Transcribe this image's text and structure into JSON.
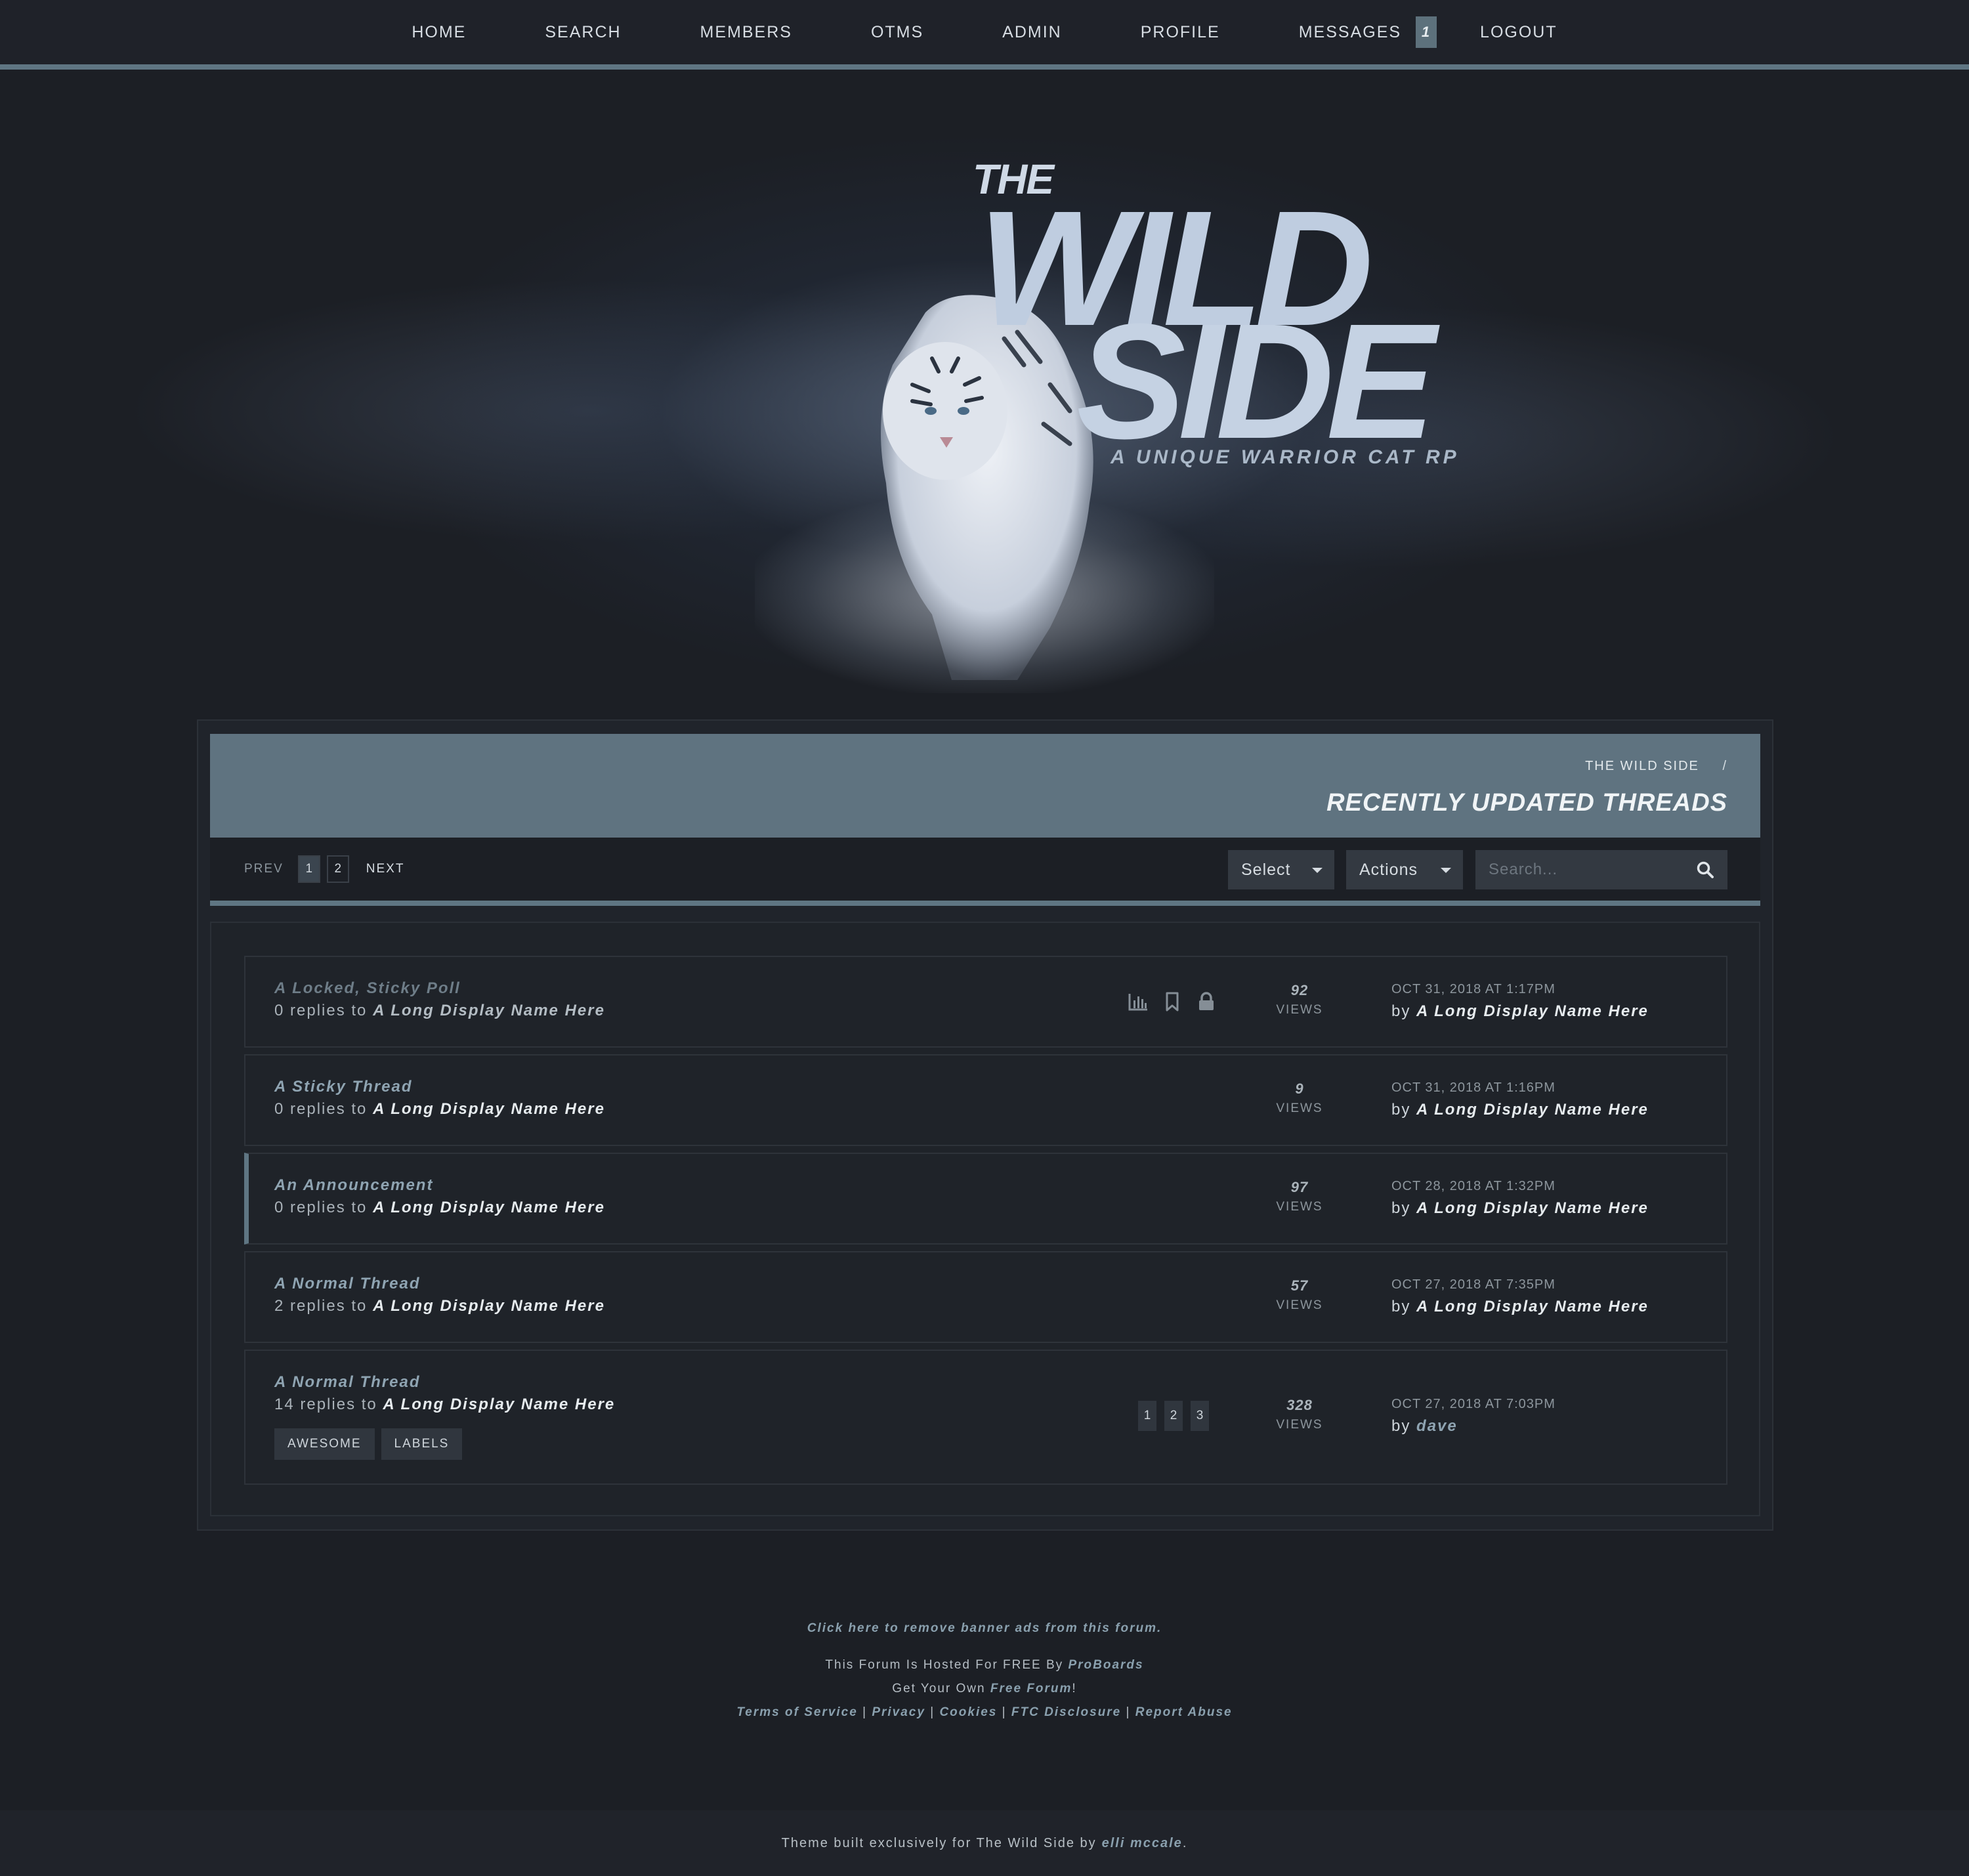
{
  "nav": {
    "items": [
      "HOME",
      "SEARCH",
      "MEMBERS",
      "OTMS",
      "ADMIN",
      "PROFILE",
      "MESSAGES",
      "LOGOUT"
    ],
    "messages_count": "1"
  },
  "banner": {
    "logo_the": "THE",
    "logo_wild": "WILD",
    "logo_side": "SIDE",
    "tagline": "A UNIQUE WARRIOR CAT RP"
  },
  "header": {
    "breadcrumb": "THE WILD SIDE",
    "breadcrumb_sep": "/",
    "title": "RECENTLY UPDATED THREADS"
  },
  "controls": {
    "prev": "PREV",
    "pages": [
      "1",
      "2"
    ],
    "active_page": "1",
    "next": "NEXT",
    "select_label": "Select",
    "actions_label": "Actions",
    "search_placeholder": "Search..."
  },
  "threads": [
    {
      "title": "A Locked, Sticky Poll",
      "replies": "0 replies to",
      "author": "A Long Display Name Here",
      "views": "92",
      "views_label": "VIEWS",
      "date": "OCT 31, 2018 AT 1:17PM",
      "by": "by",
      "last_author": "A Long Display Name Here",
      "icons": [
        "poll-icon",
        "bookmark-icon",
        "lock-icon"
      ]
    },
    {
      "title": "A Sticky Thread",
      "replies": "0 replies to",
      "author": "A Long Display Name Here",
      "views": "9",
      "views_label": "VIEWS",
      "date": "OCT 31, 2018 AT 1:16PM",
      "by": "by",
      "last_author": "A Long Display Name Here"
    },
    {
      "title": "An Announcement",
      "replies": "0 replies to",
      "author": "A Long Display Name Here",
      "views": "97",
      "views_label": "VIEWS",
      "date": "OCT 28, 2018 AT 1:32PM",
      "by": "by",
      "last_author": "A Long Display Name Here"
    },
    {
      "title": "A Normal Thread",
      "replies": "2 replies to",
      "author": "A Long Display Name Here",
      "views": "57",
      "views_label": "VIEWS",
      "date": "OCT 27, 2018 AT 7:35PM",
      "by": "by",
      "last_author": "A Long Display Name Here"
    },
    {
      "title": "A Normal Thread",
      "replies": "14 replies to",
      "author": "A Long Display Name Here",
      "views": "328",
      "views_label": "VIEWS",
      "date": "OCT 27, 2018 AT 7:03PM",
      "by": "by",
      "last_author": "dave",
      "pages": [
        "1",
        "2",
        "3"
      ],
      "labels": [
        "AWESOME",
        "LABELS"
      ]
    }
  ],
  "footer": {
    "remove_ads": "Click here to remove banner ads from this forum.",
    "hosted_prefix": "This Forum Is Hosted For FREE By",
    "hosted_link": "ProBoards",
    "own_prefix": "Get Your Own",
    "own_link": "Free Forum",
    "own_suffix": "!",
    "legal_links": [
      "Terms of Service",
      "Privacy",
      "Cookies",
      "FTC Disclosure",
      "Report Abuse"
    ],
    "legal_sep": "|",
    "credit_prefix": "Theme built exclusively for The Wild Side by",
    "credit_link": "elli mccale",
    "credit_suffix": "."
  },
  "colors": {
    "background": "#1c1f25",
    "accent": "#5f7683",
    "link": "#8fa4b2"
  }
}
